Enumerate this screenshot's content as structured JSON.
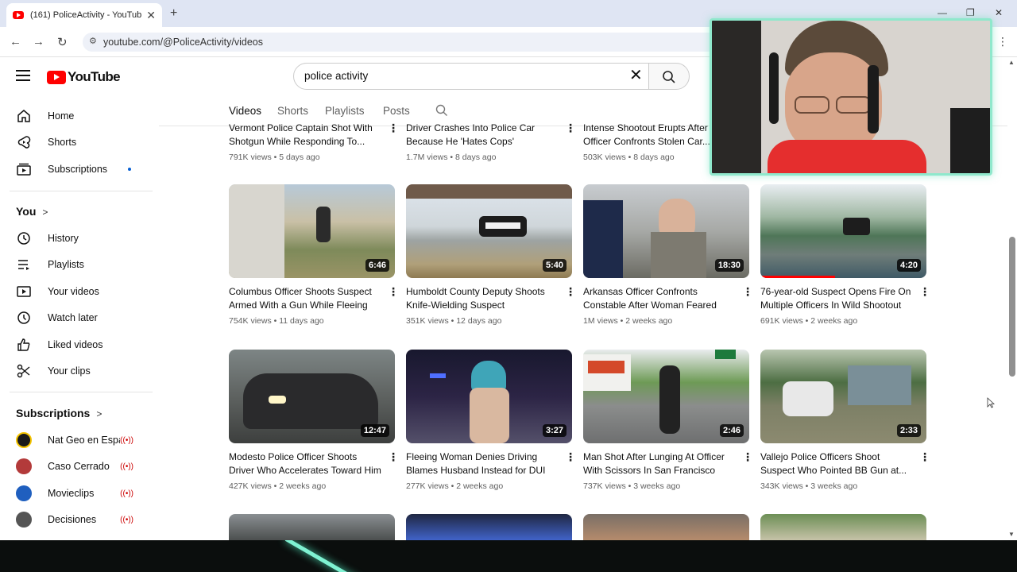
{
  "browser": {
    "tab_title": "(161) PoliceActivity - YouTube",
    "url": "youtube.com/@PoliceActivity/videos"
  },
  "masthead": {
    "logo_text": "YouTube",
    "search_value": "police activity"
  },
  "sidebar": {
    "main": [
      {
        "label": "Home",
        "icon": "home-icon"
      },
      {
        "label": "Shorts",
        "icon": "shorts-icon"
      },
      {
        "label": "Subscriptions",
        "icon": "subscriptions-icon"
      }
    ],
    "you_heading": "You",
    "you_items": [
      {
        "label": "History",
        "icon": "history-icon"
      },
      {
        "label": "Playlists",
        "icon": "playlists-icon"
      },
      {
        "label": "Your videos",
        "icon": "your-videos-icon"
      },
      {
        "label": "Watch later",
        "icon": "watch-later-icon"
      },
      {
        "label": "Liked videos",
        "icon": "liked-videos-icon"
      },
      {
        "label": "Your clips",
        "icon": "clips-icon"
      }
    ],
    "subscriptions_heading": "Subscriptions",
    "channels": [
      {
        "name": "Nat Geo en Espa...",
        "color": "#1a1a1a"
      },
      {
        "name": "Caso Cerrado",
        "color": "#b33a3a"
      },
      {
        "name": "Movieclips",
        "color": "#1f5fbf"
      },
      {
        "name": "Decisiones",
        "color": "#555555"
      }
    ]
  },
  "channel_tabs": [
    "Videos",
    "Shorts",
    "Playlists",
    "Posts"
  ],
  "videos": [
    {
      "title": "Vermont Police Captain Shot With Shotgun While Responding To...",
      "views": "791K views",
      "age": "5 days ago",
      "duration": ""
    },
    {
      "title": "Driver Crashes Into Police Car Because He 'Hates Cops'",
      "views": "1.7M views",
      "age": "8 days ago",
      "duration": ""
    },
    {
      "title": "Intense Shootout Erupts After Officer Confronts Stolen Car...",
      "views": "503K views",
      "age": "8 days ago",
      "duration": ""
    },
    {
      "title": "Columbus Officer Shoots Suspect Armed With a Gun While Fleeing a...",
      "views": "754K views",
      "age": "11 days ago",
      "duration": "6:46"
    },
    {
      "title": "Humboldt County Deputy Shoots Knife-Wielding Suspect Advancing...",
      "views": "351K views",
      "age": "12 days ago",
      "duration": "5:40"
    },
    {
      "title": "Arkansas Officer Confronts Constable After Woman Feared He...",
      "views": "1M views",
      "age": "2 weeks ago",
      "duration": "18:30"
    },
    {
      "title": "76-year-old Suspect Opens Fire On Multiple Officers In Wild Shootout",
      "views": "691K views",
      "age": "2 weeks ago",
      "duration": "4:20",
      "watched_fraction": 0.45
    },
    {
      "title": "Modesto Police Officer Shoots Driver Who Accelerates Toward Him",
      "views": "427K views",
      "age": "2 weeks ago",
      "duration": "12:47"
    },
    {
      "title": "Fleeing Woman Denies Driving Blames Husband Instead for DUI",
      "views": "277K views",
      "age": "2 weeks ago",
      "duration": "3:27"
    },
    {
      "title": "Man Shot After Lunging At Officer With Scissors In San Francisco",
      "views": "737K views",
      "age": "3 weeks ago",
      "duration": "2:46"
    },
    {
      "title": "Vallejo Police Officers Shoot Suspect Who Pointed BB Gun at...",
      "views": "343K views",
      "age": "3 weeks ago",
      "duration": "2:33"
    }
  ],
  "colors": {
    "accent_red": "#ff0000",
    "webcam_border": "#8fe8cc"
  }
}
